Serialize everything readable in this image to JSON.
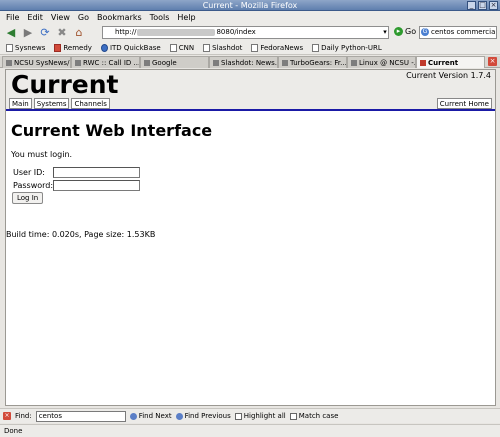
{
  "window": {
    "title": "Current - Mozilla Firefox"
  },
  "menu": [
    "File",
    "Edit",
    "View",
    "Go",
    "Bookmarks",
    "Tools",
    "Help"
  ],
  "navbar": {
    "url_prefix": "http://",
    "url_suffix": "8080/index",
    "go_label": "Go",
    "search_value": "centos commercial"
  },
  "bookmarks": [
    {
      "label": "Sysnews",
      "icon": "page-icon"
    },
    {
      "label": "Remedy",
      "icon": "remedy-icon"
    },
    {
      "label": "ITD QuickBase",
      "icon": "quickbase-icon"
    },
    {
      "label": "CNN",
      "icon": "page-icon"
    },
    {
      "label": "Slashdot",
      "icon": "page-icon"
    },
    {
      "label": "FedoraNews",
      "icon": "page-icon"
    },
    {
      "label": "Daily Python-URL",
      "icon": "page-icon"
    }
  ],
  "tabs": [
    {
      "label": "NCSU SysNews/..."
    },
    {
      "label": "RWC :: Call ID ..."
    },
    {
      "label": "Google"
    },
    {
      "label": "Slashdot: News..."
    },
    {
      "label": "TurboGears: Fr..."
    },
    {
      "label": "Linux @ NCSU -..."
    },
    {
      "label": "Current"
    }
  ],
  "site": {
    "title": "Current",
    "version": "Current Version 1.7.4",
    "nav": [
      "Main",
      "Systems",
      "Channels"
    ],
    "home_button": "Current Home"
  },
  "page": {
    "heading": "Current Web Interface",
    "login_message": "You must login.",
    "userid_label": "User ID:",
    "password_label": "Password:",
    "login_button": "Log In",
    "build_info": "Build time: 0.020s, Page size: 1.53KB"
  },
  "findbar": {
    "label": "Find:",
    "value": "centos",
    "find_next": "Find Next",
    "find_previous": "Find Previous",
    "highlight_all": "Highlight all",
    "match_case": "Match case"
  },
  "status": {
    "text": "Done"
  }
}
